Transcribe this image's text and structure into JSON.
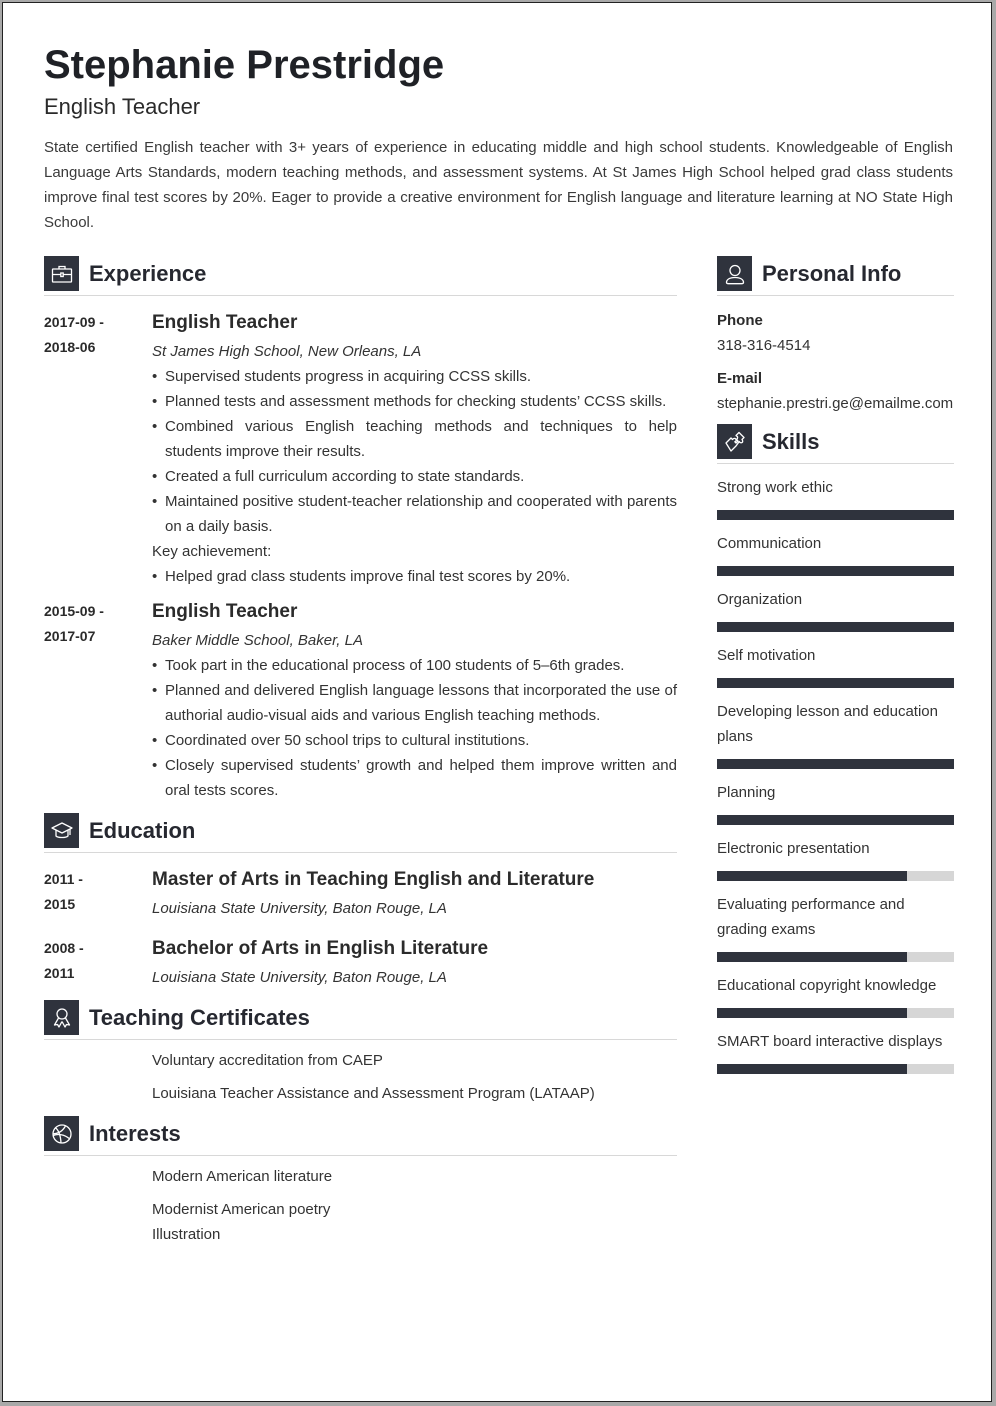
{
  "header": {
    "name": "Stephanie Prestridge",
    "title": "English Teacher",
    "summary": "State certified English teacher with 3+ years of experience in educating middle and high school students. Knowledgeable of English Language Arts Standards, modern teaching methods, and assessment systems. At St James High School helped grad class students improve final test scores by 20%. Eager to provide a creative environment for English language and literature learning at NO State High School."
  },
  "sections": {
    "experience": "Experience",
    "education": "Education",
    "certificates": "Teaching Certificates",
    "interests": "Interests",
    "personal_info": "Personal Info",
    "skills": "Skills"
  },
  "experience": [
    {
      "date_start": "2017-09 -",
      "date_end": "2018-06",
      "role": "English Teacher",
      "place": "St James High School, New Orleans, LA",
      "bullets": [
        "Supervised students progress in acquiring CCSS skills.",
        "Planned tests and assessment methods for checking students’ CCSS skills.",
        "Combined various English teaching methods and techniques to help students improve their results.",
        "Created a full curriculum according to state standards.",
        "Maintained positive student-teacher relationship and cooperated with parents on a daily basis."
      ],
      "key_label": "Key achievement:",
      "key_bullets": [
        "Helped grad class students improve final test scores by 20%."
      ]
    },
    {
      "date_start": "2015-09 -",
      "date_end": "2017-07",
      "role": "English Teacher",
      "place": "Baker Middle School, Baker, LA",
      "bullets": [
        "Took part in the educational process of 100 students of 5–6th grades.",
        "Planned and delivered English language lessons that incorporated the use of authorial audio-visual aids and various English teaching methods.",
        "Coordinated over 50 school trips to cultural institutions.",
        "Closely supervised students’ growth and helped them improve written and oral tests scores."
      ]
    }
  ],
  "education": [
    {
      "date_start": "2011 -",
      "date_end": "2015",
      "degree": "Master of Arts in Teaching English and Literature",
      "place": "Louisiana State University, Baton Rouge, LA"
    },
    {
      "date_start": "2008 -",
      "date_end": "2011",
      "degree": "Bachelor of Arts in English Literature",
      "place": "Louisiana State University, Baton Rouge, LA"
    }
  ],
  "certificates": [
    "Voluntary accreditation from CAEP",
    "Louisiana Teacher Assistance and Assessment Program (LATAAP)"
  ],
  "interests": [
    "Modern American literature",
    "Modernist American poetry",
    "Illustration"
  ],
  "personal_info": {
    "phone_label": "Phone",
    "phone": "318-316-4514",
    "email_label": "E-mail",
    "email": "stephanie.prestri.ge@emailme.com"
  },
  "skills": [
    {
      "name": "Strong work ethic",
      "level": 1.0
    },
    {
      "name": "Communication",
      "level": 1.0
    },
    {
      "name": "Organization",
      "level": 1.0
    },
    {
      "name": "Self motivation",
      "level": 1.0
    },
    {
      "name": "Developing lesson and education plans",
      "level": 1.0
    },
    {
      "name": "Planning",
      "level": 1.0
    },
    {
      "name": "Electronic presentation",
      "level": 0.8
    },
    {
      "name": "Evaluating performance and grading exams",
      "level": 0.8
    },
    {
      "name": "Educational copyright knowledge",
      "level": 0.8
    },
    {
      "name": "SMART board interactive displays",
      "level": 0.8
    }
  ],
  "icons": {
    "experience": "briefcase-icon",
    "education": "graduation-cap-icon",
    "certificates": "award-ribbon-icon",
    "interests": "basketball-icon",
    "personal_info": "user-icon",
    "skills": "puzzle-piece-icon"
  },
  "colors": {
    "accent": "#2f333d",
    "bar_track": "#d6d6d6",
    "divider": "#d8d8d8"
  }
}
